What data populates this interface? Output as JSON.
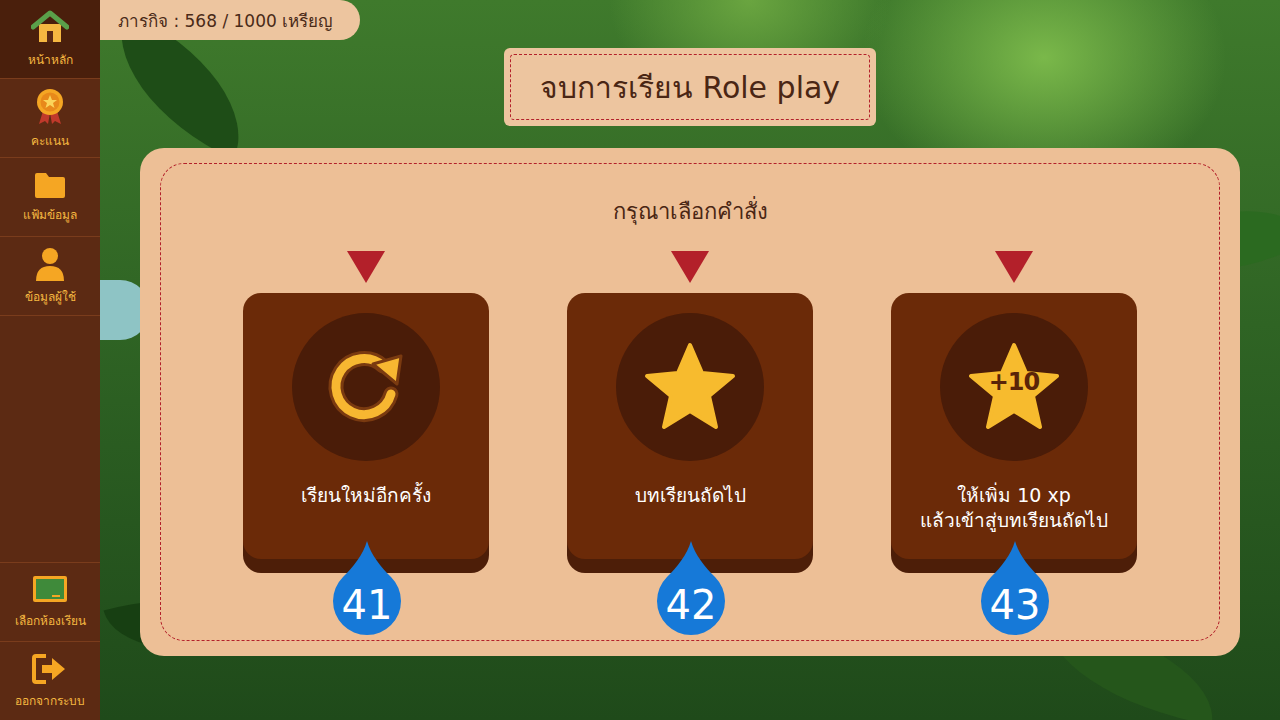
{
  "sidebar": {
    "items": [
      {
        "label": "หน้าหลัก",
        "kind": "home",
        "selected": true
      },
      {
        "label": "คะแนน",
        "kind": "score",
        "selected": false
      },
      {
        "label": "แฟ้มข้อมูล",
        "kind": "folder",
        "selected": false
      },
      {
        "label": "ข้อมูลผู้ใช้",
        "kind": "user",
        "selected": false
      }
    ],
    "bottom_items": [
      {
        "label": "เลือกห้องเรียน",
        "kind": "classroom",
        "selected": false
      },
      {
        "label": "ออกจากระบบ",
        "kind": "logout",
        "selected": false
      }
    ]
  },
  "mission": "ภารกิจ : 568 / 1000 เหรียญ",
  "title": "จบการเรียน Role play",
  "panel": {
    "prompt": "กรุณาเลือกคำสั่ง",
    "options": [
      {
        "kind": "retry",
        "lines": [
          "เรียนใหม่อีกครั้ง"
        ],
        "badge": "",
        "marker": "41"
      },
      {
        "kind": "star",
        "lines": [
          "บทเรียนถัดไป"
        ],
        "badge": "",
        "marker": "42"
      },
      {
        "kind": "bonus",
        "lines": [
          "ให้เพิ่ม 10 xp",
          "แล้วเข้าสู่บทเรียนถัดไป"
        ],
        "badge": "+10",
        "marker": "43"
      }
    ]
  }
}
